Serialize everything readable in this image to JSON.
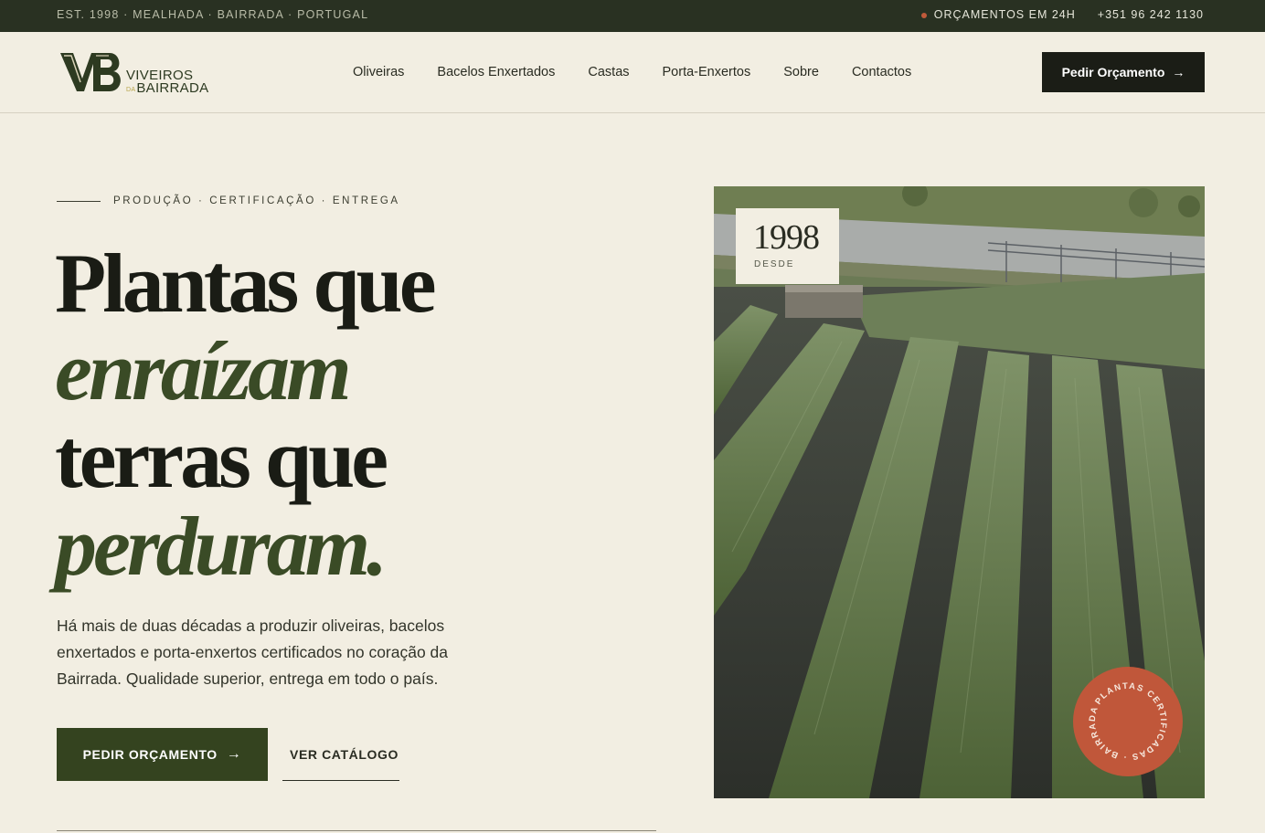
{
  "topbar": {
    "tagline": "EST. 1998 · MEALHADA · BAIRRADA · PORTUGAL",
    "quote_notice": "ORÇAMENTOS EM 24H",
    "phone": "+351 96 242 1130"
  },
  "brand": {
    "monogram": "VB",
    "name_line1": "VIVEIROS",
    "name_da": "DA",
    "name_line2": "BAIRRADA"
  },
  "nav": {
    "items": [
      "Oliveiras",
      "Bacelos Enxertados",
      "Castas",
      "Porta-Enxertos",
      "Sobre",
      "Contactos"
    ]
  },
  "header": {
    "cta_label": "Pedir Orçamento",
    "cta_arrow": "→"
  },
  "hero": {
    "eyebrow": "PRODUÇÃO · CERTIFICAÇÃO · ENTREGA",
    "headline_line1": "Plantas que",
    "headline_line2": "enraízam",
    "headline_line3": "terras que",
    "headline_line4": "perduram.",
    "lead": "Há mais de duas décadas a produzir oliveiras, bacelos enxertados e porta-enxertos certificados no coração da Bairrada. Qualidade superior, entrega em todo o país.",
    "primary_cta": "PEDIR ORÇAMENTO",
    "primary_arrow": "→",
    "secondary_cta": "VER CATÁLOGO"
  },
  "year_card": {
    "year": "1998",
    "label": "DESDE"
  },
  "badge": {
    "text": "PLANTAS CERTIFICADAS · BAIRRADA ·"
  },
  "colors": {
    "background": "#f2eee2",
    "topbar": "#293122",
    "accent_green": "#34431f",
    "headline_italic": "#3a4b26",
    "badge": "#c0573a",
    "dark_button": "#1b1d16"
  }
}
